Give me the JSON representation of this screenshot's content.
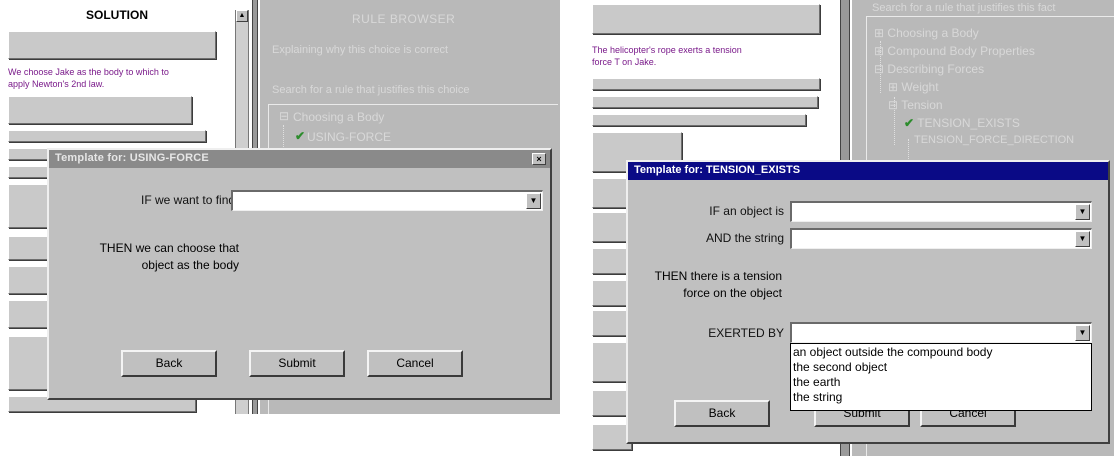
{
  "left": {
    "solution_header": "SOLUTION",
    "solution_note": "We choose Jake as the body to which to apply Newton's 2nd law.",
    "rule_browser": {
      "title": "RULE BROWSER",
      "explaining": "Explaining why this choice is correct",
      "search": "Search for a rule that justifies this choice",
      "tree": {
        "node": "Choosing a Body",
        "node_symbol": "⊟",
        "child": "USING-FORCE",
        "check": "✔"
      }
    },
    "dialog": {
      "title": "Template for: USING-FORCE",
      "close_glyph": "×",
      "if_label": "IF we want to find",
      "if_value": "",
      "then_text": "THEN we can choose that object as the body",
      "back": "Back",
      "submit": "Submit",
      "cancel": "Cancel"
    }
  },
  "right": {
    "solution_note": "The helicopter's rope exerts a tension force T on Jake.",
    "rule_browser": {
      "search": "Search for a rule that justifies this fact",
      "tree": [
        {
          "symbol": "⊞",
          "label": "Choosing a Body"
        },
        {
          "symbol": "⊞",
          "label": "Compound Body Properties"
        },
        {
          "symbol": "⊟",
          "label": "Describing Forces"
        },
        {
          "symbol": "⊞",
          "label": "Weight"
        },
        {
          "symbol": "⊟",
          "label": "Tension"
        },
        {
          "symbol": "✔",
          "label": "TENSION_EXISTS"
        },
        {
          "symbol": "",
          "label": "TENSION_FORCE_DIRECTION"
        }
      ]
    },
    "dialog": {
      "title": "Template for: TENSION_EXISTS",
      "if_label": "IF an object is",
      "and_label": "AND the string",
      "then_text": "THEN there is a tension force on the object",
      "exerted_label": "EXERTED BY",
      "if_value": "",
      "and_value": "",
      "exerted_value": "",
      "dropdown_options": [
        "an object outside the compound body",
        "the second object",
        "the earth",
        "the string"
      ],
      "back": "Back",
      "submit": "Submit",
      "cancel": "Cancel"
    }
  },
  "glyphs": {
    "dropdown_arrow": "▼",
    "scroll_up": "▲"
  }
}
